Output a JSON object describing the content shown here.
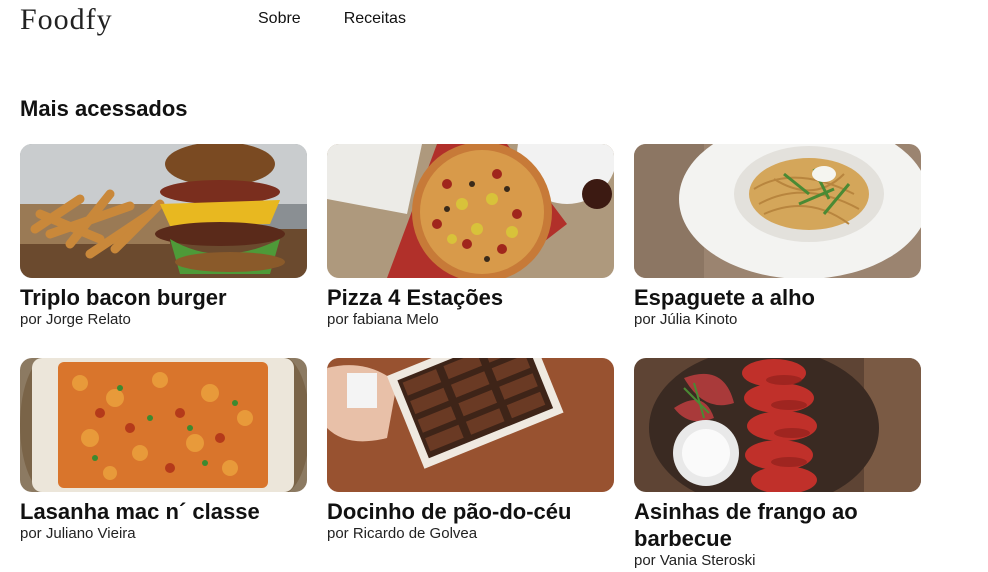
{
  "header": {
    "logo": "Foodfy",
    "nav": [
      {
        "label": "Sobre"
      },
      {
        "label": "Receitas"
      }
    ]
  },
  "section": {
    "title": "Mais acessados"
  },
  "recipes": [
    {
      "title": "Triplo bacon burger",
      "author": "por Jorge Relato",
      "image": "burger-photo"
    },
    {
      "title": "Pizza 4 Estações",
      "author": "por fabiana Melo",
      "image": "pizza-photo"
    },
    {
      "title": "Espaguete a alho",
      "author": "por Júlia Kinoto",
      "image": "spaghetti-photo"
    },
    {
      "title": "Lasanha mac n´ classe",
      "author": "por Juliano Vieira",
      "image": "lasagna-photo"
    },
    {
      "title": "Docinho de pão-do-céu",
      "author": "por Ricardo de Golvea",
      "image": "chocolates-photo"
    },
    {
      "title": "Asinhas de frango ao barbecue",
      "author": "por Vania Steroski",
      "image": "chicken-wings-photo"
    }
  ]
}
